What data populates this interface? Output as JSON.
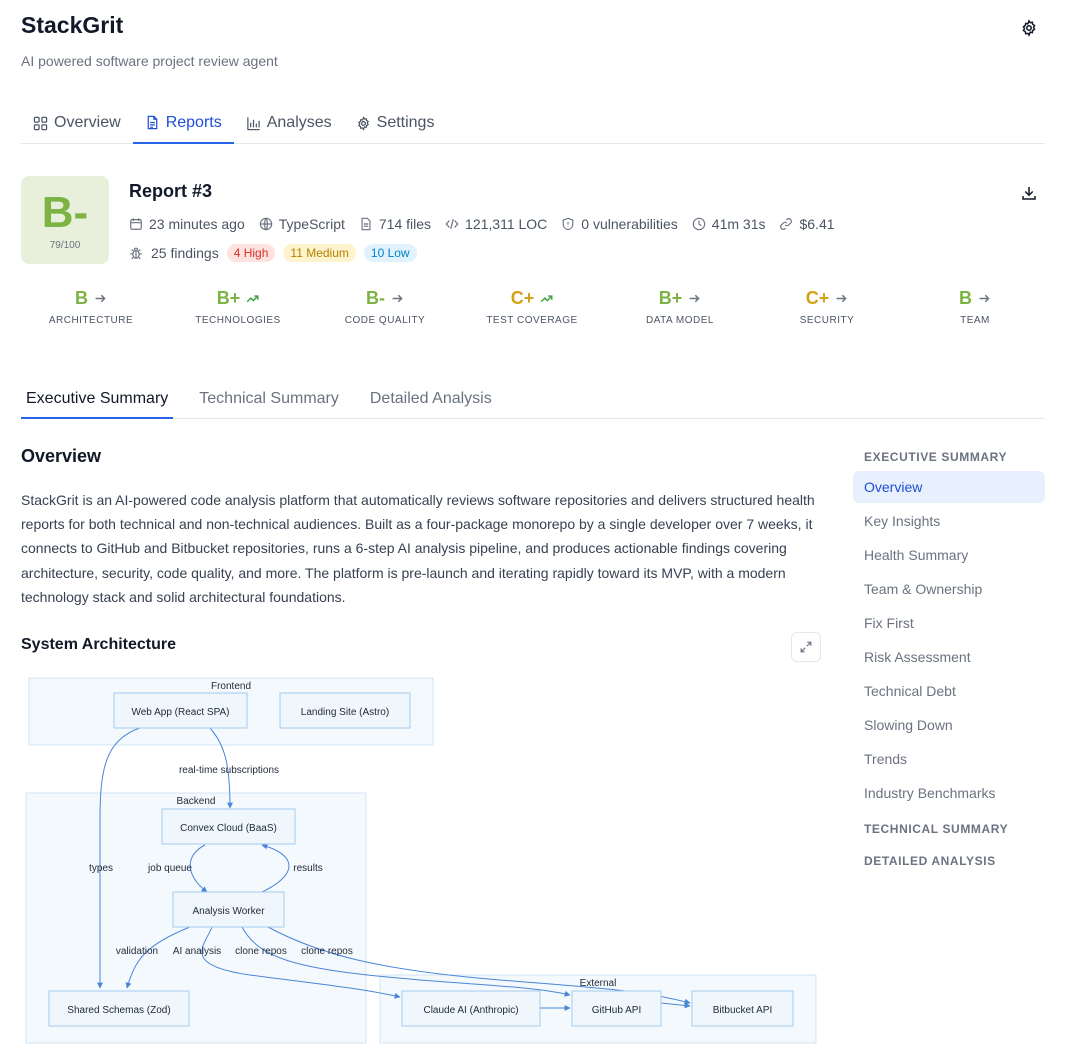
{
  "app": {
    "title": "StackGrit",
    "subtitle": "AI powered software project review agent"
  },
  "main_tabs": [
    {
      "label": "Overview",
      "icon": "grid-icon"
    },
    {
      "label": "Reports",
      "icon": "document-icon",
      "active": true
    },
    {
      "label": "Analyses",
      "icon": "bar-chart-icon"
    },
    {
      "label": "Settings",
      "icon": "gear-icon"
    }
  ],
  "report": {
    "title": "Report #3",
    "grade": "B-",
    "score": "79/100",
    "meta": {
      "time": "23 minutes ago",
      "language": "TypeScript",
      "files": "714 files",
      "loc": "121,311 LOC",
      "vulnerabilities": "0 vulnerabilities",
      "duration": "41m 31s",
      "cost": "$6.41"
    },
    "findings": {
      "total": "25 findings",
      "high": "4 High",
      "medium": "11 Medium",
      "low": "10 Low"
    }
  },
  "categories": [
    {
      "grade": "B",
      "label": "ARCHITECTURE",
      "trend": "flat",
      "color": "#7cb342"
    },
    {
      "grade": "B+",
      "label": "TECHNOLOGIES",
      "trend": "up",
      "color": "#7cb342"
    },
    {
      "grade": "B-",
      "label": "CODE QUALITY",
      "trend": "flat",
      "color": "#7cb342"
    },
    {
      "grade": "C+",
      "label": "TEST COVERAGE",
      "trend": "up",
      "color": "#d4a017"
    },
    {
      "grade": "B+",
      "label": "DATA MODEL",
      "trend": "flat",
      "color": "#7cb342"
    },
    {
      "grade": "C+",
      "label": "SECURITY",
      "trend": "flat",
      "color": "#d4a017"
    },
    {
      "grade": "B",
      "label": "TEAM",
      "trend": "flat",
      "color": "#7cb342"
    }
  ],
  "sub_tabs": [
    {
      "label": "Executive Summary",
      "active": true
    },
    {
      "label": "Technical Summary"
    },
    {
      "label": "Detailed Analysis"
    }
  ],
  "overview": {
    "heading": "Overview",
    "body": "StackGrit is an AI-powered code analysis platform that automatically reviews software repositories and delivers structured health reports for both technical and non-technical audiences. Built as a four-package monorepo by a single developer over 7 weeks, it connects to GitHub and Bitbucket repositories, runs a 6-step AI analysis pipeline, and produces actionable findings covering architecture, security, code quality, and more. The platform is pre-launch and iterating rapidly toward its MVP, with a modern technology stack and solid architectural foundations."
  },
  "architecture": {
    "heading": "System Architecture",
    "groups": {
      "frontend": "Frontend",
      "backend": "Backend",
      "external": "External"
    },
    "nodes": {
      "webapp": "Web App (React SPA)",
      "landing": "Landing Site (Astro)",
      "convex": "Convex Cloud (BaaS)",
      "worker": "Analysis Worker",
      "schemas": "Shared Schemas (Zod)",
      "claude": "Claude AI (Anthropic)",
      "github": "GitHub API",
      "bitbucket": "Bitbucket API"
    },
    "edges": {
      "realtime": "real-time subscriptions",
      "types": "types",
      "jobqueue": "job queue",
      "results": "results",
      "validation": "validation",
      "ai": "AI analysis",
      "clone1": "clone repos",
      "clone2": "clone repos"
    }
  },
  "toc": {
    "executive": "EXECUTIVE SUMMARY",
    "items": [
      {
        "label": "Overview",
        "active": true
      },
      {
        "label": "Key Insights"
      },
      {
        "label": "Health Summary"
      },
      {
        "label": "Team & Ownership"
      },
      {
        "label": "Fix First"
      },
      {
        "label": "Risk Assessment"
      },
      {
        "label": "Technical Debt"
      },
      {
        "label": "Slowing Down"
      },
      {
        "label": "Trends"
      },
      {
        "label": "Industry Benchmarks"
      }
    ],
    "technical": "TECHNICAL SUMMARY",
    "detailed": "DETAILED ANALYSIS"
  }
}
